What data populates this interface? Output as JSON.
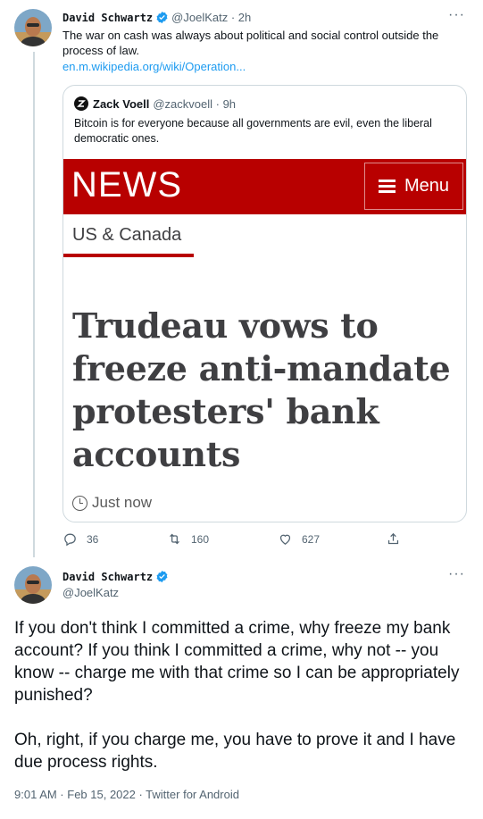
{
  "tweet1": {
    "author_name": "David Schwartz",
    "handle": "@JoelKatz",
    "time": "2h",
    "text": "The war on cash was always about political and social control outside the process of law.",
    "link": "en.m.wikipedia.org/wiki/Operation...",
    "more_icon": "more-icon",
    "quote": {
      "author_name": "Zack Voell",
      "handle": "@zackvoell",
      "time": "9h",
      "text": "Bitcoin is for everyone because all governments are evil, even the liberal democratic ones.",
      "news": {
        "logo": "NEWS",
        "menu_label": "Menu",
        "section": "US & Canada",
        "headline": "Trudeau vows to freeze anti-mandate protesters' bank accounts",
        "time": "Just now",
        "colors": {
          "brand_red": "#b80000"
        }
      }
    },
    "actions": {
      "replies": "36",
      "retweets": "160",
      "likes": "627"
    }
  },
  "tweet2": {
    "author_name": "David Schwartz",
    "handle": "@JoelKatz",
    "paragraphs": [
      "If you don't think I committed a crime, why freeze my bank account? If you think I committed a crime, why not -- you know -- charge me with that crime so I can be appropriately punished?",
      "Oh, right, if you charge me, you have to prove it and I have due process rights."
    ],
    "meta": "9:01 AM · Feb 15, 2022 · Twitter for Android"
  },
  "colors": {
    "link_blue": "#1d9bf0",
    "verified_blue": "#1d9bf0",
    "secondary_text": "#536471"
  }
}
